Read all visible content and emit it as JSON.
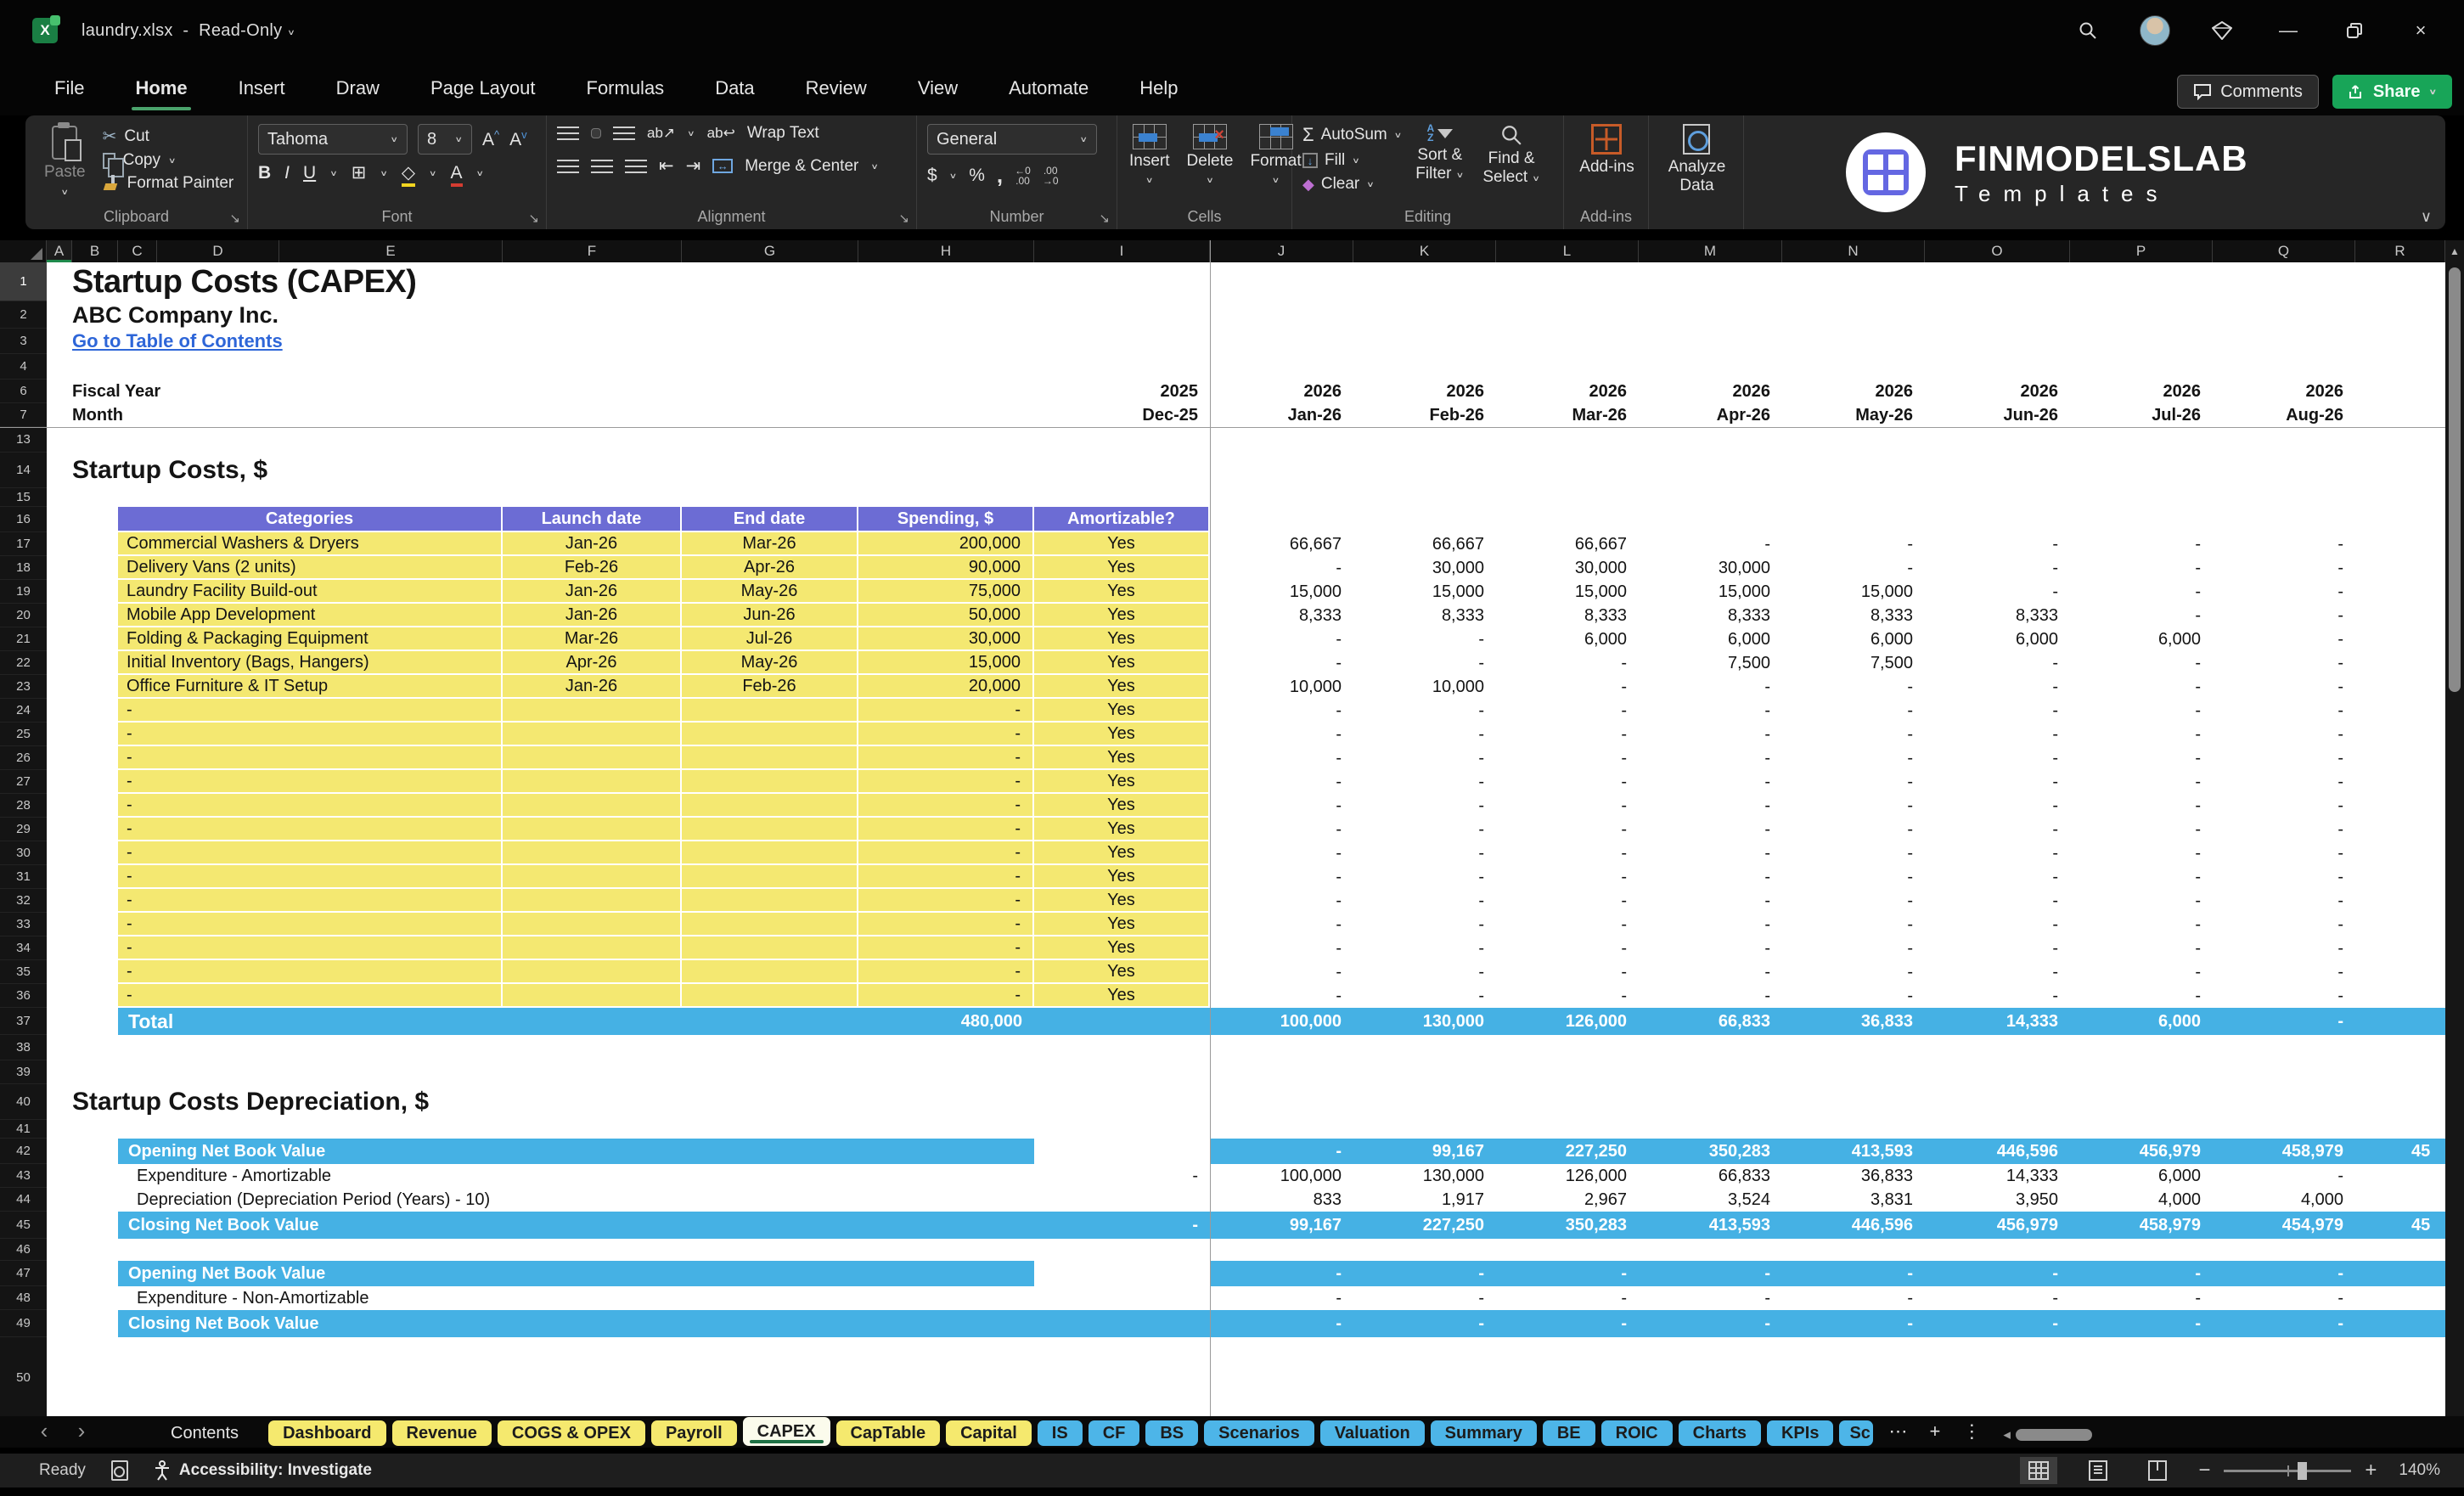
{
  "window": {
    "file_name": "laundry.xlsx",
    "mode": "Read-Only"
  },
  "ribbon": {
    "tabs": [
      "File",
      "Home",
      "Insert",
      "Draw",
      "Page Layout",
      "Formulas",
      "Data",
      "Review",
      "View",
      "Automate",
      "Help"
    ],
    "active_tab": "Home",
    "comments": "Comments",
    "share": "Share",
    "groups": {
      "clipboard": {
        "label": "Clipboard",
        "paste": "Paste",
        "cut": "Cut",
        "copy": "Copy",
        "format_painter": "Format Painter"
      },
      "font": {
        "label": "Font",
        "family": "Tahoma",
        "size": "8"
      },
      "alignment": {
        "label": "Alignment",
        "wrap": "Wrap Text",
        "merge": "Merge & Center"
      },
      "number": {
        "label": "Number",
        "format": "General"
      },
      "cells": {
        "label": "Cells",
        "insert": "Insert",
        "delete": "Delete",
        "format": "Format"
      },
      "editing": {
        "label": "Editing",
        "autosum": "AutoSum",
        "fill": "Fill",
        "clear": "Clear",
        "sort_1": "Sort &",
        "sort_2": "Filter",
        "find_1": "Find &",
        "find_2": "Select"
      },
      "addins": {
        "label": "Add-ins",
        "button": "Add-ins",
        "analyze_1": "Analyze",
        "analyze_2": "Data"
      }
    },
    "brand": {
      "name": "FINMODELSLAB",
      "sub": "Templates"
    }
  },
  "grid": {
    "columns": [
      "A",
      "B",
      "C",
      "D",
      "E",
      "F",
      "G",
      "H",
      "I",
      "J",
      "K",
      "L",
      "M",
      "N",
      "O",
      "P",
      "Q",
      "R"
    ]
  },
  "sheet": {
    "rows": [
      {
        "n": "1",
        "h": 46,
        "t": "text",
        "cls": "c-title",
        "text": "Startup Costs (CAPEX)"
      },
      {
        "n": "2",
        "h": 32,
        "t": "text",
        "cls": "c-company",
        "text": "ABC Company Inc."
      },
      {
        "n": "3",
        "h": 30,
        "t": "link",
        "cls": "c-link",
        "text": "Go to Table of Contents"
      },
      {
        "n": "4",
        "h": 30,
        "t": "blank"
      },
      {
        "n": "6",
        "h": 28,
        "t": "mrow",
        "label": "Fiscal Year",
        "i": "2025",
        "vals": [
          "2026",
          "2026",
          "2026",
          "2026",
          "2026",
          "2026",
          "2026",
          "2026"
        ]
      },
      {
        "n": "7",
        "h": 28,
        "t": "mrow",
        "label": "Month",
        "i": "Dec-25",
        "vals": [
          "Jan-26",
          "Feb-26",
          "Mar-26",
          "Apr-26",
          "May-26",
          "Jun-26",
          "Jul-26",
          "Aug-26"
        ]
      },
      {
        "n": "13",
        "h": 30,
        "t": "blank"
      },
      {
        "n": "14",
        "h": 42,
        "t": "text",
        "cls": "c-section",
        "text": "Startup Costs, $"
      },
      {
        "n": "15",
        "h": 22,
        "t": "blank"
      },
      {
        "n": "16",
        "h": 30,
        "t": "thead",
        "headers": [
          "Categories",
          "Launch date",
          "End date",
          "Spending, $",
          "Amortizable?"
        ]
      },
      {
        "n": "17",
        "h": 28,
        "t": "trow",
        "cat": "Commercial Washers & Dryers",
        "launch": "Jan-26",
        "end": "Mar-26",
        "spend": "200,000",
        "amort": "Yes",
        "vals": [
          "66,667",
          "66,667",
          "66,667",
          "-",
          "-",
          "-",
          "-",
          "-"
        ]
      },
      {
        "n": "18",
        "h": 28,
        "t": "trow",
        "cat": "Delivery Vans (2 units)",
        "launch": "Feb-26",
        "end": "Apr-26",
        "spend": "90,000",
        "amort": "Yes",
        "vals": [
          "-",
          "30,000",
          "30,000",
          "30,000",
          "-",
          "-",
          "-",
          "-"
        ]
      },
      {
        "n": "19",
        "h": 28,
        "t": "trow",
        "cat": "Laundry Facility Build-out",
        "launch": "Jan-26",
        "end": "May-26",
        "spend": "75,000",
        "amort": "Yes",
        "vals": [
          "15,000",
          "15,000",
          "15,000",
          "15,000",
          "15,000",
          "-",
          "-",
          "-"
        ]
      },
      {
        "n": "20",
        "h": 28,
        "t": "trow",
        "cat": "Mobile App Development",
        "launch": "Jan-26",
        "end": "Jun-26",
        "spend": "50,000",
        "amort": "Yes",
        "vals": [
          "8,333",
          "8,333",
          "8,333",
          "8,333",
          "8,333",
          "8,333",
          "-",
          "-"
        ]
      },
      {
        "n": "21",
        "h": 28,
        "t": "trow",
        "cat": "Folding & Packaging Equipment",
        "launch": "Mar-26",
        "end": "Jul-26",
        "spend": "30,000",
        "amort": "Yes",
        "vals": [
          "-",
          "-",
          "6,000",
          "6,000",
          "6,000",
          "6,000",
          "6,000",
          "-"
        ]
      },
      {
        "n": "22",
        "h": 28,
        "t": "trow",
        "cat": "Initial Inventory (Bags, Hangers)",
        "launch": "Apr-26",
        "end": "May-26",
        "spend": "15,000",
        "amort": "Yes",
        "vals": [
          "-",
          "-",
          "-",
          "7,500",
          "7,500",
          "-",
          "-",
          "-"
        ]
      },
      {
        "n": "23",
        "h": 28,
        "t": "trow",
        "cat": "Office Furniture & IT Setup",
        "launch": "Jan-26",
        "end": "Feb-26",
        "spend": "20,000",
        "amort": "Yes",
        "vals": [
          "10,000",
          "10,000",
          "-",
          "-",
          "-",
          "-",
          "-",
          "-"
        ]
      },
      {
        "repeat": [
          24,
          36
        ],
        "h": 28,
        "t": "trow",
        "cat": "-",
        "launch": "",
        "end": "",
        "spend": "-",
        "amort": "Yes",
        "vals": [
          "-",
          "-",
          "-",
          "-",
          "-",
          "-",
          "-",
          "-"
        ]
      },
      {
        "n": "37",
        "h": 32,
        "t": "total",
        "label": "Total",
        "spend": "480,000",
        "vals": [
          "100,000",
          "130,000",
          "126,000",
          "66,833",
          "36,833",
          "14,333",
          "6,000",
          "-"
        ]
      },
      {
        "n": "38",
        "h": 30,
        "t": "blank"
      },
      {
        "n": "39",
        "h": 28,
        "t": "blank"
      },
      {
        "n": "40",
        "h": 42,
        "t": "text",
        "cls": "c-section",
        "text": "Startup Costs Depreciation, $"
      },
      {
        "n": "41",
        "h": 22,
        "t": "blank"
      },
      {
        "n": "42",
        "h": 30,
        "t": "bandopen",
        "label": "Opening Net Book Value",
        "vals": [
          "-",
          "99,167",
          "227,250",
          "350,283",
          "413,593",
          "446,596",
          "456,979",
          "458,979"
        ],
        "r": "45"
      },
      {
        "n": "43",
        "h": 28,
        "t": "plain",
        "label": "Expenditure - Amortizable",
        "i": "-",
        "vals": [
          "100,000",
          "130,000",
          "126,000",
          "66,833",
          "36,833",
          "14,333",
          "6,000",
          "-"
        ]
      },
      {
        "n": "44",
        "h": 28,
        "t": "plain",
        "label": "Depreciation (Depreciation Period (Years) - 10)",
        "vals": [
          "833",
          "1,917",
          "2,967",
          "3,524",
          "3,831",
          "3,950",
          "4,000",
          "4,000"
        ]
      },
      {
        "n": "45",
        "h": 32,
        "t": "bandclose",
        "label": "Closing Net Book Value",
        "i": "-",
        "vals": [
          "99,167",
          "227,250",
          "350,283",
          "413,593",
          "446,596",
          "456,979",
          "458,979",
          "454,979"
        ],
        "r": "45"
      },
      {
        "n": "46",
        "h": 26,
        "t": "blank"
      },
      {
        "n": "47",
        "h": 30,
        "t": "bandopen",
        "label": "Opening Net Book Value",
        "vals": [
          "-",
          "-",
          "-",
          "-",
          "-",
          "-",
          "-",
          "-"
        ]
      },
      {
        "n": "48",
        "h": 28,
        "t": "plain",
        "label": "Expenditure - Non-Amortizable",
        "vals": [
          "-",
          "-",
          "-",
          "-",
          "-",
          "-",
          "-",
          "-"
        ]
      },
      {
        "n": "49",
        "h": 32,
        "t": "bandclose",
        "label": "Closing Net Book Value",
        "vals": [
          "-",
          "-",
          "-",
          "-",
          "-",
          "-",
          "-",
          "-"
        ]
      },
      {
        "n": "50",
        "h": 96,
        "t": "blank"
      }
    ]
  },
  "sheet_tabs": {
    "tabs": [
      {
        "label": "Contents",
        "style": "dark"
      },
      {
        "label": "Dashboard",
        "style": "yellow"
      },
      {
        "label": "Revenue",
        "style": "yellow"
      },
      {
        "label": "COGS & OPEX",
        "style": "yellow"
      },
      {
        "label": "Payroll",
        "style": "yellow"
      },
      {
        "label": "CAPEX",
        "style": "active"
      },
      {
        "label": "CapTable",
        "style": "yellow"
      },
      {
        "label": "Capital",
        "style": "yellow"
      },
      {
        "label": "IS",
        "style": "blue"
      },
      {
        "label": "CF",
        "style": "blue"
      },
      {
        "label": "BS",
        "style": "blue"
      },
      {
        "label": "Scenarios",
        "style": "blue"
      },
      {
        "label": "Valuation",
        "style": "blue"
      },
      {
        "label": "Summary",
        "style": "blue"
      },
      {
        "label": "BE",
        "style": "blue"
      },
      {
        "label": "ROIC",
        "style": "blue"
      },
      {
        "label": "Charts",
        "style": "blue"
      },
      {
        "label": "KPIs",
        "style": "blue"
      },
      {
        "label": "Sc",
        "style": "blue-clipped"
      }
    ]
  },
  "status_bar": {
    "ready": "Ready",
    "accessibility": "Accessibility: Investigate",
    "zoom": "140%"
  },
  "colors": {
    "accent_green": "#21a366",
    "band_blue": "#45b1e4",
    "table_yellow": "#f4e871",
    "header_purple": "#6c6cd4",
    "link_blue": "#2e66d8",
    "tab_blue": "#4db5e8",
    "tab_yellow": "#f5e96e"
  }
}
